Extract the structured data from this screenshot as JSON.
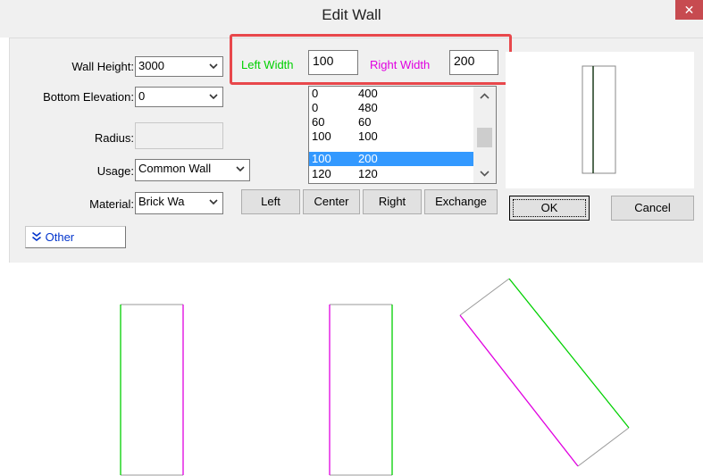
{
  "window": {
    "title": "Edit Wall",
    "close_glyph": "✕"
  },
  "form": {
    "wall_height": {
      "label": "Wall Height:",
      "value": "3000"
    },
    "bottom_elevation": {
      "label": "Bottom Elevation:",
      "value": "0"
    },
    "radius": {
      "label": "Radius:",
      "value": ""
    },
    "usage": {
      "label": "Usage:",
      "value": "Common Wall"
    },
    "material": {
      "label": "Material:",
      "value": "Brick Wa"
    }
  },
  "widths": {
    "left_label": "Left Width",
    "left_value": "100",
    "right_label": "Right Width",
    "right_value": "200",
    "left_color": "#00d000",
    "right_color": "#e000e0",
    "highlight_color": "#e8474b"
  },
  "width_presets": [
    {
      "left": "0",
      "right": "400",
      "selected": false
    },
    {
      "left": "0",
      "right": "480",
      "selected": false
    },
    {
      "left": "60",
      "right": "60",
      "selected": false
    },
    {
      "left": "100",
      "right": "100",
      "selected": false
    },
    {
      "left": "100",
      "right": "200",
      "selected": true
    },
    {
      "left": "120",
      "right": "120",
      "selected": false
    }
  ],
  "align_buttons": {
    "left": "Left",
    "center": "Center",
    "right": "Right",
    "exchange": "Exchange"
  },
  "actions": {
    "ok": "OK",
    "cancel": "Cancel"
  },
  "other": {
    "label": "Other",
    "icon": "double-chevron-down-icon"
  }
}
